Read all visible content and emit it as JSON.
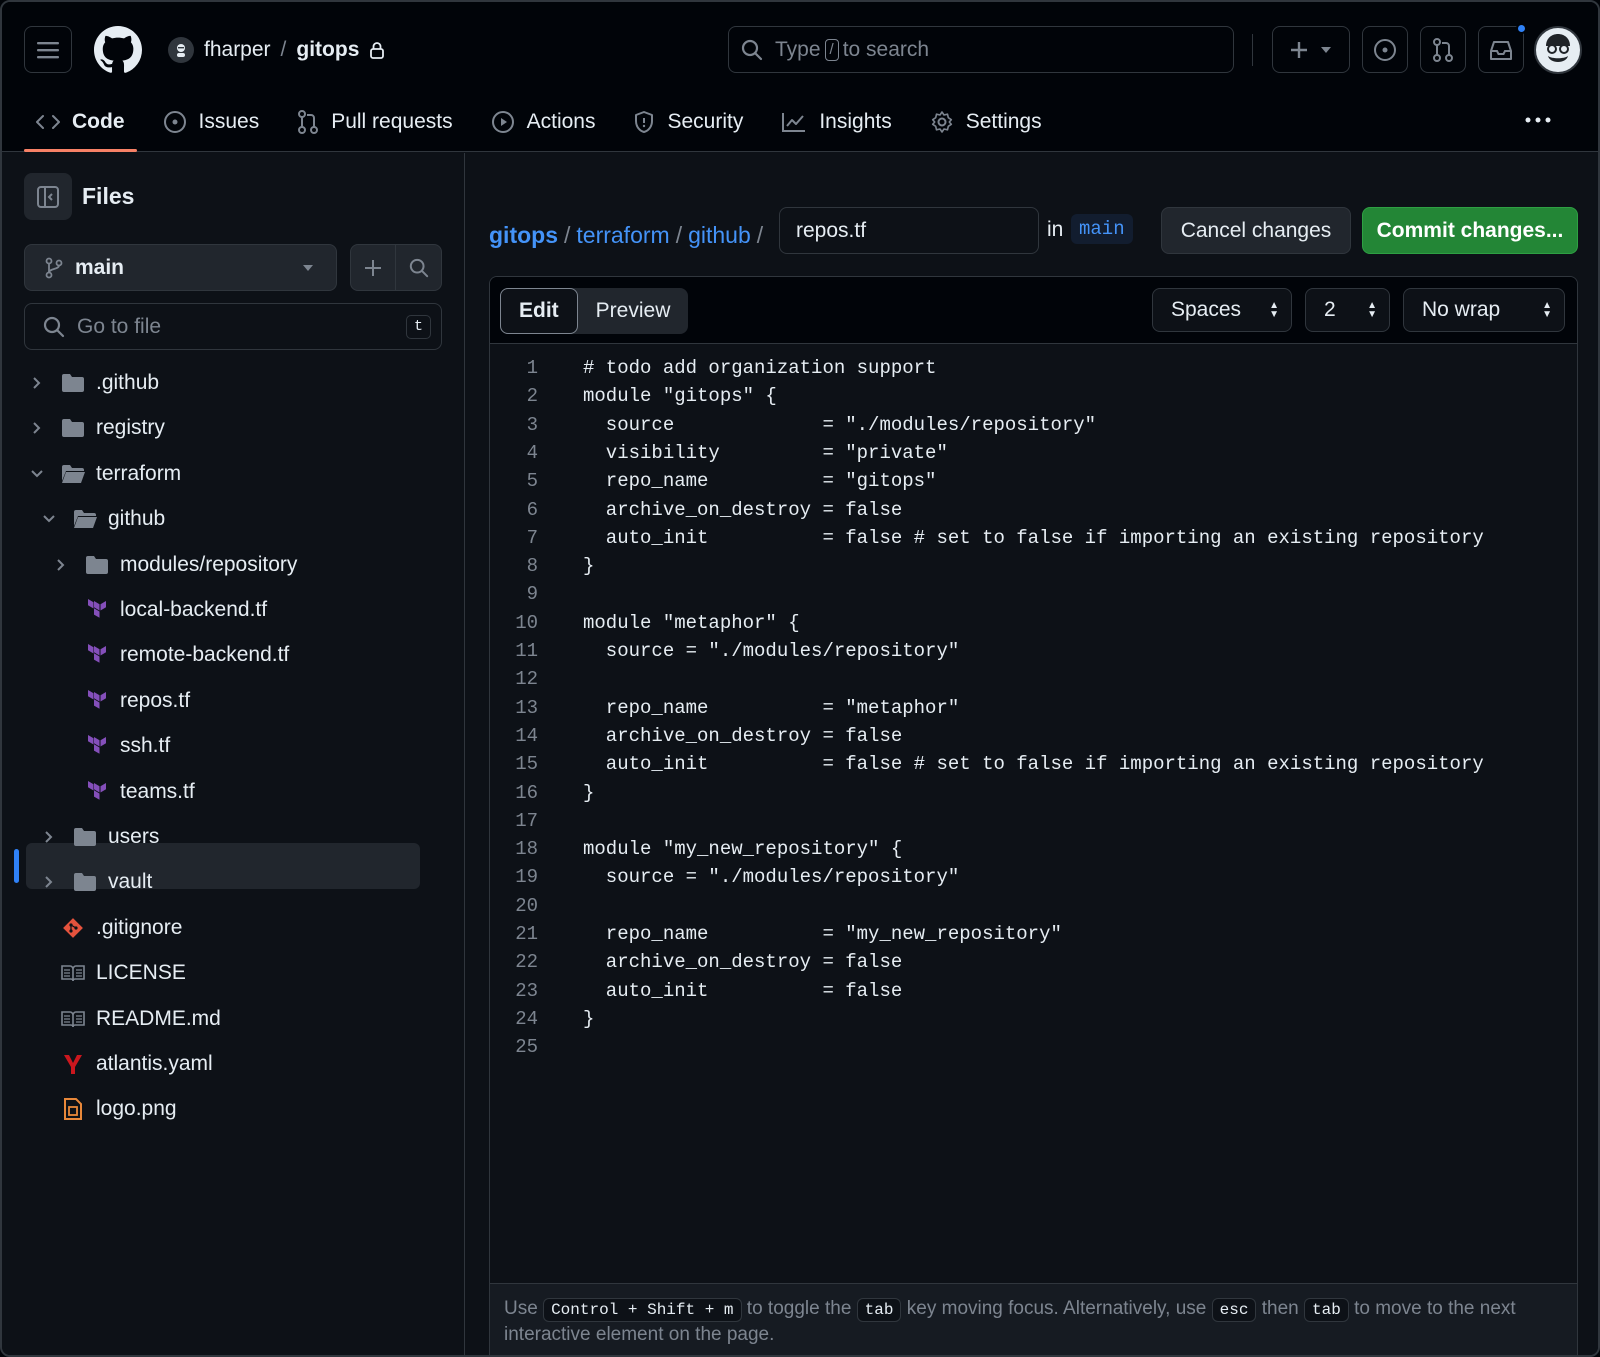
{
  "header": {
    "owner": "fharper",
    "path_sep": "/",
    "repo": "gitops",
    "search_prefix": "Type",
    "search_key": "/",
    "search_suffix": "to search"
  },
  "tabs": [
    {
      "label": "Code",
      "icon": "code-icon"
    },
    {
      "label": "Issues",
      "icon": "issue-opened-icon"
    },
    {
      "label": "Pull requests",
      "icon": "git-pull-request-icon"
    },
    {
      "label": "Actions",
      "icon": "play-icon"
    },
    {
      "label": "Security",
      "icon": "shield-icon"
    },
    {
      "label": "Insights",
      "icon": "graph-icon"
    },
    {
      "label": "Settings",
      "icon": "gear-icon"
    }
  ],
  "sidebar": {
    "title": "Files",
    "branch": "main",
    "goto_placeholder": "Go to file",
    "goto_key": "t",
    "tree": [
      {
        "label": ".github",
        "kind": "folder",
        "expanded": false,
        "depth": 0
      },
      {
        "label": "registry",
        "kind": "folder",
        "expanded": false,
        "depth": 0
      },
      {
        "label": "terraform",
        "kind": "folder",
        "expanded": true,
        "depth": 0
      },
      {
        "label": "github",
        "kind": "folder",
        "expanded": true,
        "depth": 1
      },
      {
        "label": "modules/repository",
        "kind": "folder",
        "expanded": false,
        "depth": 2
      },
      {
        "label": "local-backend.tf",
        "kind": "terraform",
        "depth": 2
      },
      {
        "label": "remote-backend.tf",
        "kind": "terraform",
        "depth": 2
      },
      {
        "label": "repos.tf",
        "kind": "terraform",
        "depth": 2,
        "selected": true
      },
      {
        "label": "ssh.tf",
        "kind": "terraform",
        "depth": 2
      },
      {
        "label": "teams.tf",
        "kind": "terraform",
        "depth": 2
      },
      {
        "label": "users",
        "kind": "folder",
        "expanded": false,
        "depth": 1
      },
      {
        "label": "vault",
        "kind": "folder",
        "expanded": false,
        "depth": 1
      },
      {
        "label": ".gitignore",
        "kind": "git",
        "depth": 0
      },
      {
        "label": "LICENSE",
        "kind": "book",
        "depth": 0
      },
      {
        "label": "README.md",
        "kind": "book",
        "depth": 0
      },
      {
        "label": "atlantis.yaml",
        "kind": "yaml",
        "depth": 0
      },
      {
        "label": "logo.png",
        "kind": "image",
        "depth": 0
      }
    ]
  },
  "breadcrumb": {
    "parts": [
      "gitops",
      "terraform",
      "github"
    ],
    "sep": "/",
    "filename": "repos.tf",
    "in_label": "in",
    "branch": "main"
  },
  "actions": {
    "cancel": "Cancel changes",
    "commit": "Commit changes..."
  },
  "editor": {
    "mode_edit": "Edit",
    "mode_preview": "Preview",
    "indent_mode": "Spaces",
    "indent_size": "2",
    "wrap_mode": "No wrap",
    "lines": [
      "# todo add organization support",
      "module \"gitops\" {",
      "  source             = \"./modules/repository\"",
      "  visibility         = \"private\"",
      "  repo_name          = \"gitops\"",
      "  archive_on_destroy = false",
      "  auto_init          = false # set to false if importing an existing repository",
      "}",
      "",
      "module \"metaphor\" {",
      "  source = \"./modules/repository\"",
      "",
      "  repo_name          = \"metaphor\"",
      "  archive_on_destroy = false",
      "  auto_init          = false # set to false if importing an existing repository",
      "}",
      "",
      "module \"my_new_repository\" {",
      "  source = \"./modules/repository\"",
      "",
      "  repo_name          = \"my_new_repository\"",
      "  archive_on_destroy = false",
      "  auto_init          = false",
      "}",
      ""
    ]
  },
  "help": {
    "t1": "Use",
    "k1": "Control + Shift + m",
    "t2": "to toggle the",
    "k2": "tab",
    "t3": "key moving focus. Alternatively, use",
    "k3": "esc",
    "t4": "then",
    "k4": "tab",
    "t5": "to move to the next interactive element on the page."
  },
  "colors": {
    "accent_blue": "#4493f8",
    "commit_green": "#238636",
    "tab_underline": "#f78166",
    "terraform_purple": "#844fba",
    "notification_dot": "#2f81f7"
  }
}
